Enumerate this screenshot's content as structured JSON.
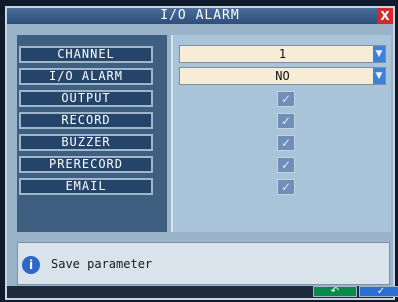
{
  "window": {
    "title": "I/O ALARM",
    "close_label": "X"
  },
  "settings": {
    "labels": [
      "CHANNEL",
      "I/O ALARM",
      "OUTPUT",
      "RECORD",
      "BUZZER",
      "PRERECORD",
      "EMAIL"
    ],
    "channel": {
      "value": "1",
      "arrow": "▼"
    },
    "io_alarm": {
      "value": "NO",
      "arrow": "▼"
    }
  },
  "checkboxes": {
    "output": {
      "checked": true,
      "glyph": "✓"
    },
    "record": {
      "checked": true,
      "glyph": "✓"
    },
    "buzzer": {
      "checked": true,
      "glyph": "✓"
    },
    "prerecord": {
      "checked": true,
      "glyph": "✓"
    },
    "email": {
      "checked": true,
      "glyph": "✓"
    }
  },
  "status": {
    "icon": "i",
    "text": "Save parameter"
  },
  "buttons": {
    "back_icon": "↶",
    "ok_icon": "✓"
  },
  "colors": {
    "title_bar": "#2d4e7b",
    "panel": "#3f5f80",
    "label_bg": "#24446a",
    "select_bg": "#f7ecd7",
    "accent": "#3e82d8",
    "close": "#d32b2b"
  }
}
